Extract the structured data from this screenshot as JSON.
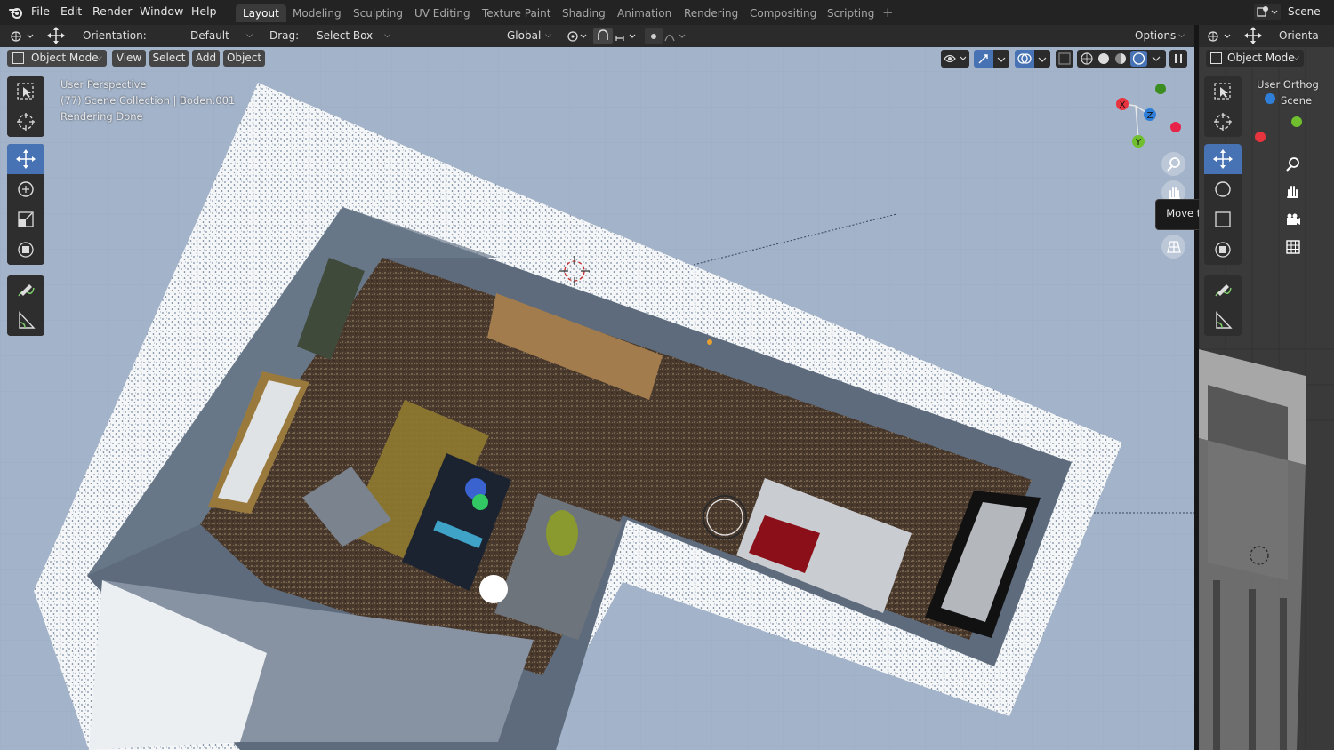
{
  "menu": [
    "File",
    "Edit",
    "Render",
    "Window",
    "Help"
  ],
  "workspace_tabs": [
    "Layout",
    "Modeling",
    "Sculpting",
    "UV Editing",
    "Texture Paint",
    "Shading",
    "Animation",
    "Rendering",
    "Compositing",
    "Scripting"
  ],
  "scene_name": "Scene",
  "header": {
    "orientation_label": "Orientation:",
    "orientation_value": "Default",
    "drag_label": "Drag:",
    "drag_value": "Select Box",
    "transform_orientation": "Global",
    "options_label": "Options"
  },
  "viewport_header": {
    "mode": "Object Mode",
    "menus": [
      "View",
      "Select",
      "Add",
      "Object"
    ]
  },
  "overlay_info": {
    "line1": "User Perspective",
    "line2": "(77) Scene Collection | Boden.001",
    "line3": "Rendering Done"
  },
  "gizmo_axes": [
    "X",
    "Y",
    "Z"
  ],
  "tooltip": "Move the view",
  "right_panel": {
    "orientation_label": "Orienta",
    "mode": "Object Mode",
    "info_line1": "User Orthog",
    "info_line2": "Scene"
  },
  "icons": {
    "blender_logo": "blender-logo-icon",
    "select_box": "select-box-icon",
    "cursor": "cursor-icon",
    "move": "move-icon",
    "rotate": "rotate-icon",
    "scale": "scale-icon",
    "transform": "transform-icon",
    "annotate": "annotate-icon",
    "measure": "measure-icon",
    "zoom": "zoom-icon",
    "pan": "hand-icon",
    "camera": "camera-icon",
    "grid": "grid-icon"
  },
  "colors": {
    "accent_blue": "#4772b3",
    "axis_x": "#e8343f",
    "axis_y": "#6fbf2f",
    "axis_z": "#2f7fd9",
    "viewport_bg": "#a3b3c9"
  }
}
